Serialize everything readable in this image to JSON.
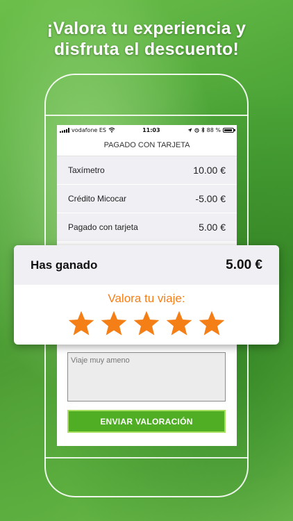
{
  "headline": {
    "line1": "¡Valora tu experiencia y",
    "line2": "disfruta el descuento!"
  },
  "status_bar": {
    "carrier": "vodafone ES",
    "time": "11:03",
    "battery_text": "88 %",
    "battery_level": 0.88,
    "icons": [
      "signal-icon",
      "wifi-icon",
      "location-icon",
      "alarm-icon",
      "bluetooth-icon",
      "battery-icon"
    ]
  },
  "screen": {
    "title": "PAGADO CON TARJETA",
    "rows": [
      {
        "label": "Taxímetro",
        "value": "10.00 €"
      },
      {
        "label": "Crédito Micocar",
        "value": "-5.00 €"
      },
      {
        "label": "Pagado con tarjeta",
        "value": "5.00 €"
      }
    ],
    "comment_placeholder": "Viaje muy ameno",
    "send_label": "ENVIAR VALORACIÓN"
  },
  "card": {
    "earned_label": "Has ganado",
    "earned_value": "5.00 €",
    "rate_label": "Valora tu viaje:",
    "rating": 5,
    "max_rating": 5
  },
  "colors": {
    "accent_orange": "#f57f17",
    "button_green": "#4fae23",
    "button_border": "#a6df5d",
    "row_bg": "#efeff4"
  }
}
